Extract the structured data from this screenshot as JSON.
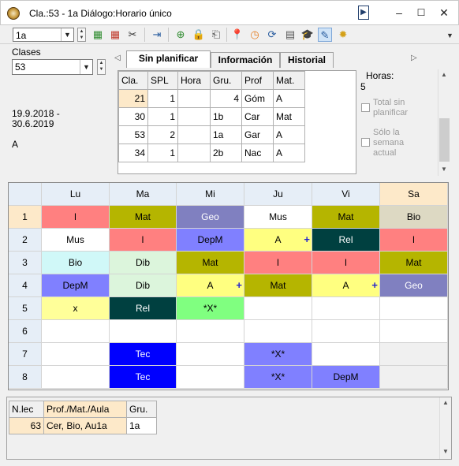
{
  "window": {
    "title": "Cla.:53 - 1a  Diálogo:Horario único",
    "pin_glyph": "▶",
    "minimize_glyph": "–",
    "maximize_glyph": "☐",
    "close_glyph": "✕"
  },
  "toolbar": {
    "class_select": "1a",
    "icons": [
      "add-lesson-icon",
      "remove-lesson-icon",
      "scissors-icon",
      "export-icon",
      "add-icon",
      "lock-icon",
      "unlock-icon",
      "pin-icon",
      "clock-icon",
      "refresh-icon",
      "calculator-icon",
      "graduation-cap-icon",
      "edit-icon",
      "settings-icon"
    ]
  },
  "left_panel": {
    "clases_label": "Clases",
    "clases_value": "53",
    "date_range": "19.9.2018 -",
    "date_range_end": "30.6.2019",
    "letter": "A"
  },
  "tabs": [
    "Sin planificar",
    "Información",
    "Historial"
  ],
  "lesson_table": {
    "headers": [
      "Cla.",
      "SPL",
      "Hora",
      "Gru.",
      "Prof",
      "Mat."
    ],
    "rows": [
      [
        "21",
        "1",
        "",
        "4",
        "Góm",
        "A"
      ],
      [
        "30",
        "1",
        "",
        "1b",
        "Car",
        "Mat"
      ],
      [
        "53",
        "2",
        "",
        "1a",
        "Gar",
        "A"
      ],
      [
        "34",
        "1",
        "",
        "2b",
        "Nac",
        "A"
      ]
    ]
  },
  "right_info": {
    "horas_label": "Horas:",
    "horas_value": "5",
    "total_label": "Total sin",
    "total_label2": "planificar",
    "solo_label": "Sólo la",
    "solo_label2": "semana",
    "solo_label3": "actual"
  },
  "timetable": {
    "days": [
      "Lu",
      "Ma",
      "Mi",
      "Ju",
      "Vi",
      "Sa"
    ],
    "periods": [
      "1",
      "2",
      "3",
      "4",
      "5",
      "6",
      "7",
      "8"
    ],
    "cells": [
      [
        {
          "t": "l",
          "bg": "#ff8080",
          "fg": "#000"
        },
        {
          "t": "Mat",
          "bg": "#b5b500",
          "fg": "#000"
        },
        {
          "t": "Geo",
          "bg": "#8080c0",
          "fg": "#fff"
        },
        {
          "t": "Mus",
          "bg": "#ffffff",
          "fg": "#000"
        },
        {
          "t": "Mat",
          "bg": "#b5b500",
          "fg": "#000"
        },
        {
          "t": "Bio",
          "bg": "#ddd9c3",
          "fg": "#000"
        }
      ],
      [
        {
          "t": "Mus",
          "bg": "#ffffff",
          "fg": "#000"
        },
        {
          "t": "l",
          "bg": "#ff8080",
          "fg": "#000"
        },
        {
          "t": "DepM",
          "bg": "#8080ff",
          "fg": "#000"
        },
        {
          "t": "A",
          "bg": "#ffff80",
          "fg": "#000",
          "plus": true
        },
        {
          "t": "Rel",
          "bg": "#004040",
          "fg": "#fff"
        },
        {
          "t": "l",
          "bg": "#ff8080",
          "fg": "#000"
        }
      ],
      [
        {
          "t": "Bio",
          "bg": "#d0f8f8",
          "fg": "#000"
        },
        {
          "t": "Dib",
          "bg": "#dcf5dc",
          "fg": "#000"
        },
        {
          "t": "Mat",
          "bg": "#b5b500",
          "fg": "#000"
        },
        {
          "t": "l",
          "bg": "#ff8080",
          "fg": "#000"
        },
        {
          "t": "l",
          "bg": "#ff8080",
          "fg": "#000"
        },
        {
          "t": "Mat",
          "bg": "#b5b500",
          "fg": "#000"
        }
      ],
      [
        {
          "t": "DepM",
          "bg": "#8080ff",
          "fg": "#000"
        },
        {
          "t": "Dib",
          "bg": "#dcf5dc",
          "fg": "#000"
        },
        {
          "t": "A",
          "bg": "#ffff80",
          "fg": "#000",
          "plus": true
        },
        {
          "t": "Mat",
          "bg": "#b5b500",
          "fg": "#000"
        },
        {
          "t": "A",
          "bg": "#ffff80",
          "fg": "#000",
          "plus": true
        },
        {
          "t": "Geo",
          "bg": "#8080c0",
          "fg": "#fff"
        }
      ],
      [
        {
          "t": "x",
          "bg": "#ffff99",
          "fg": "#000"
        },
        {
          "t": "Rel",
          "bg": "#004040",
          "fg": "#fff"
        },
        {
          "t": "*X*",
          "bg": "#80ff80",
          "fg": "#000"
        },
        {
          "t": "",
          "bg": "#ffffff",
          "fg": "#000"
        },
        {
          "t": "",
          "bg": "#ffffff",
          "fg": "#000"
        },
        {
          "t": "",
          "bg": "#ffffff",
          "fg": "#000"
        }
      ],
      [
        {
          "t": "",
          "bg": "#ffffff",
          "fg": "#000"
        },
        {
          "t": "",
          "bg": "#ffffff",
          "fg": "#000"
        },
        {
          "t": "",
          "bg": "#ffffff",
          "fg": "#000"
        },
        {
          "t": "",
          "bg": "#ffffff",
          "fg": "#000"
        },
        {
          "t": "",
          "bg": "#ffffff",
          "fg": "#000"
        },
        {
          "t": "",
          "bg": "#ffffff",
          "fg": "#000"
        }
      ],
      [
        {
          "t": "",
          "bg": "#ffffff",
          "fg": "#000"
        },
        {
          "t": "Tec",
          "bg": "#0000ff",
          "fg": "#fff"
        },
        {
          "t": "",
          "bg": "#ffffff",
          "fg": "#000"
        },
        {
          "t": "*X*",
          "bg": "#8080ff",
          "fg": "#000"
        },
        {
          "t": "",
          "bg": "#ffffff",
          "fg": "#000"
        },
        {
          "t": "",
          "bg": "#f0f0f0",
          "fg": "#000"
        }
      ],
      [
        {
          "t": "",
          "bg": "#ffffff",
          "fg": "#000"
        },
        {
          "t": "Tec",
          "bg": "#0000ff",
          "fg": "#fff"
        },
        {
          "t": "",
          "bg": "#ffffff",
          "fg": "#000"
        },
        {
          "t": "*X*",
          "bg": "#8080ff",
          "fg": "#000"
        },
        {
          "t": "DepM",
          "bg": "#8080ff",
          "fg": "#000"
        },
        {
          "t": "",
          "bg": "#f0f0f0",
          "fg": "#000"
        }
      ]
    ],
    "header_bg": "#e6eef7",
    "sat_header_bg": "#fde9c9",
    "period1_bg": "#fde9c9"
  },
  "bottom_table": {
    "headers": [
      "N.lec",
      "Prof./Mat./Aula",
      "Gru."
    ],
    "row": [
      "63",
      "Cer, Bio, Au1a",
      "1a"
    ],
    "highlight_bg": "#fde9c9"
  }
}
